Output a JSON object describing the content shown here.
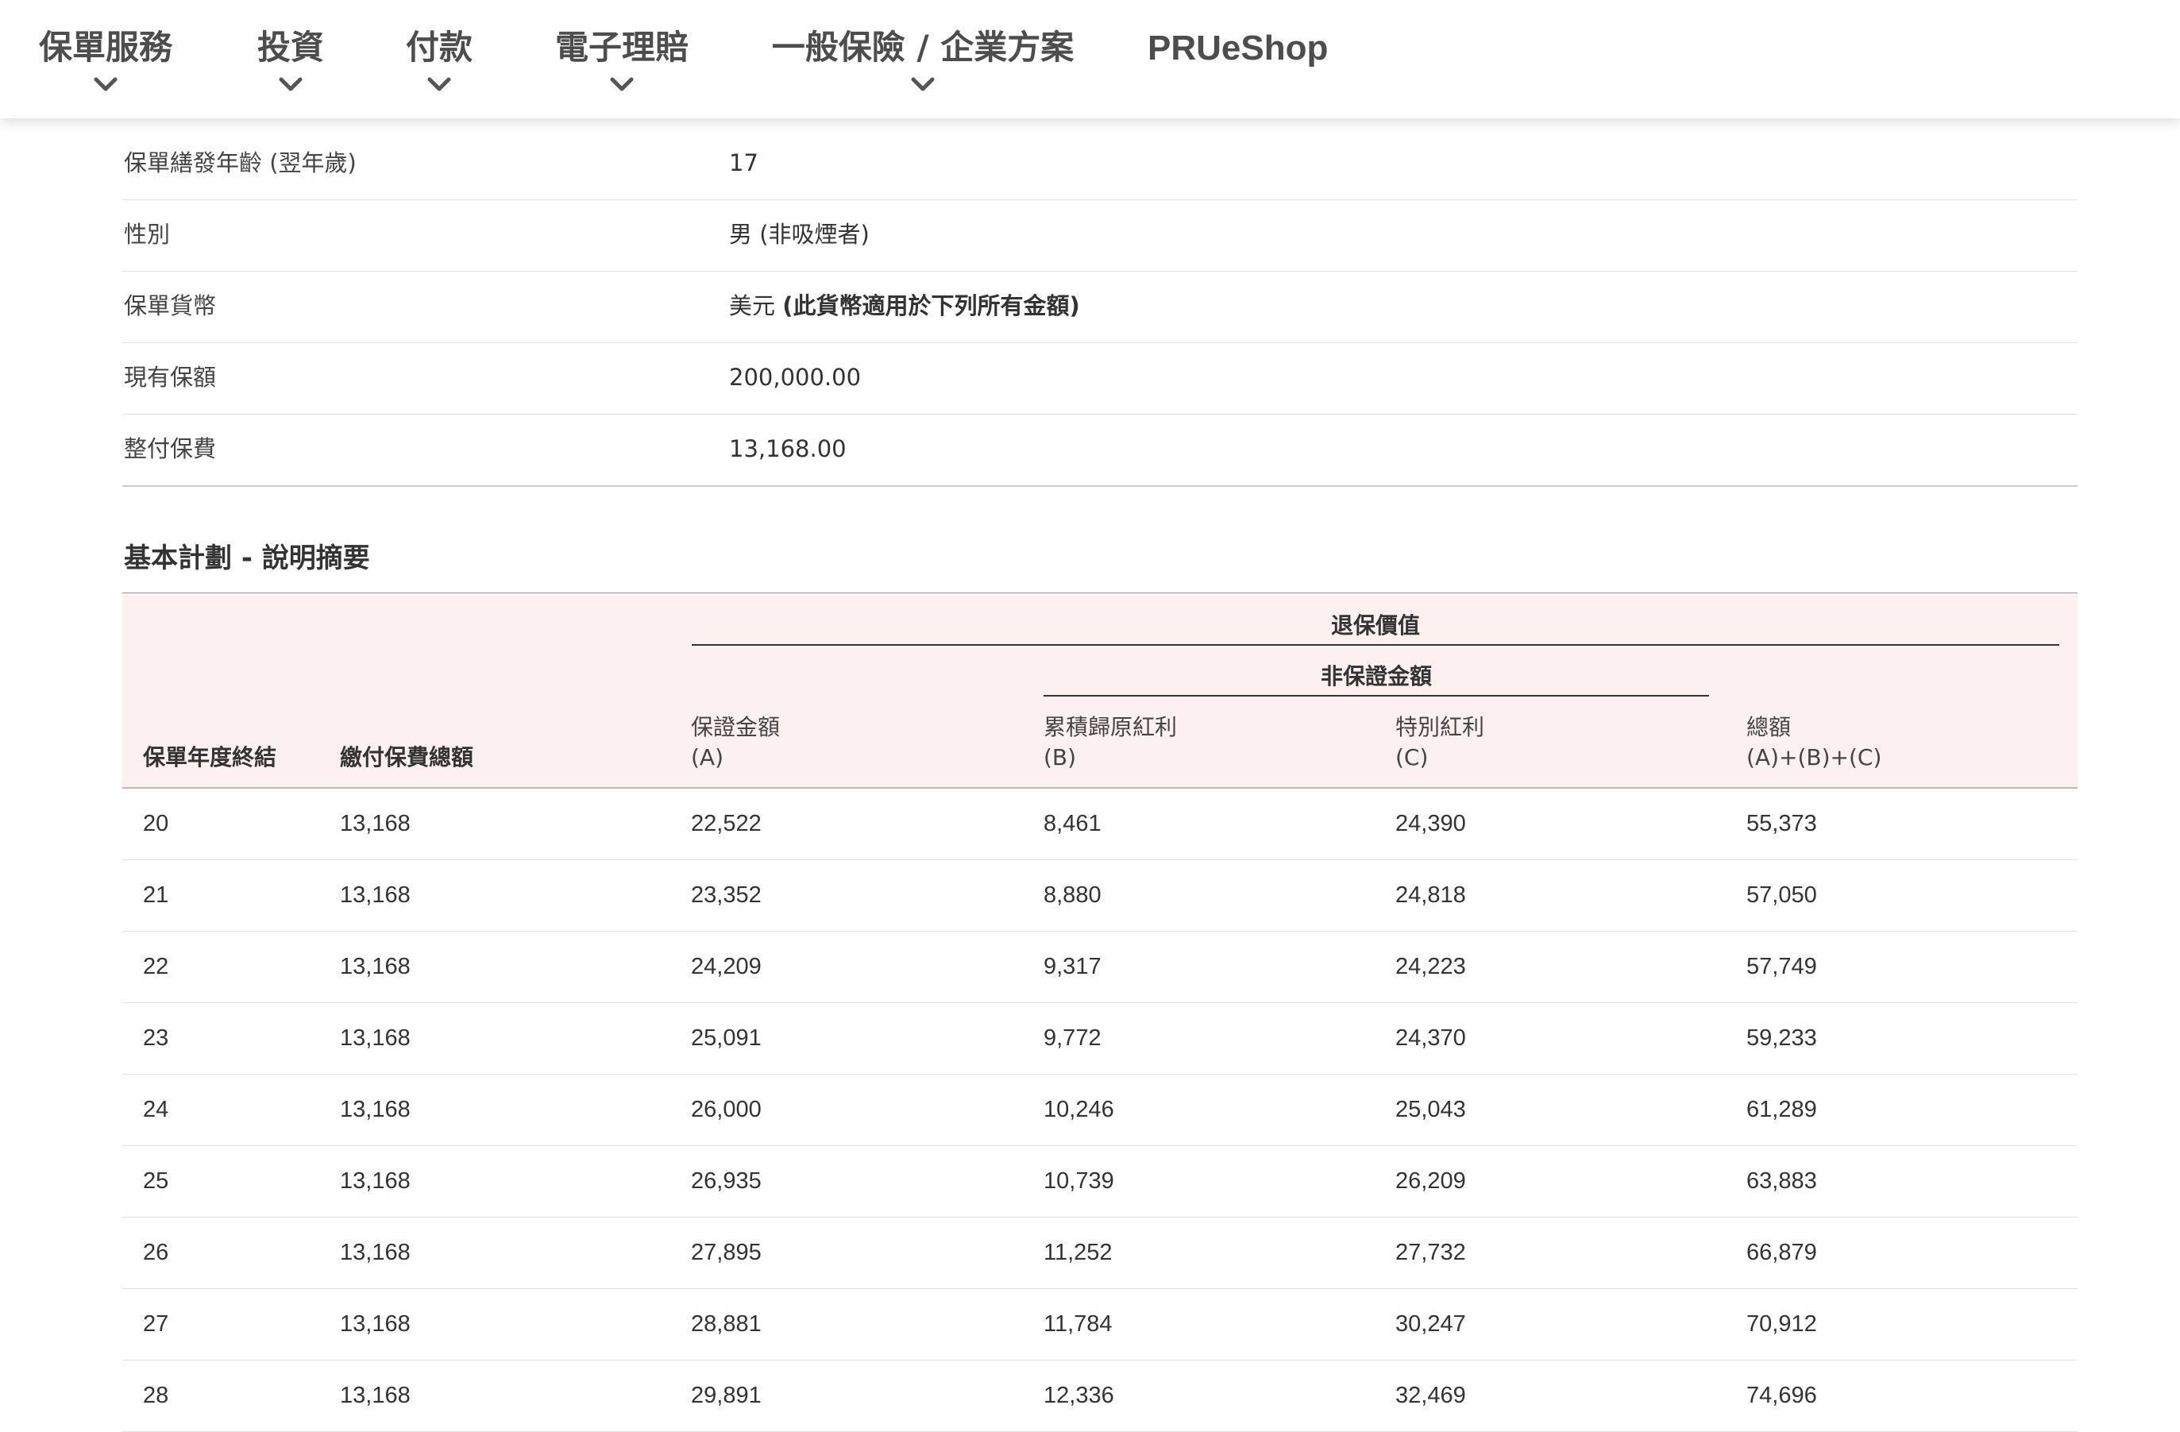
{
  "nav": {
    "items": [
      {
        "label": "保單服務",
        "has_dropdown": true
      },
      {
        "label": "投資",
        "has_dropdown": true
      },
      {
        "label": "付款",
        "has_dropdown": true
      },
      {
        "label": "電子理賠",
        "has_dropdown": true
      },
      {
        "label": "一般保險 / 企業方案",
        "has_dropdown": true
      },
      {
        "label": "PRUeShop",
        "has_dropdown": false
      }
    ]
  },
  "policy_info": [
    {
      "label": "保單繕發年齡 (翌年歲)",
      "value": "17",
      "value_note": ""
    },
    {
      "label": "性別",
      "value": "男 (非吸煙者)",
      "value_note": ""
    },
    {
      "label": "保單貨幣",
      "value": "美元",
      "value_note": "(此貨幣適用於下列所有金額)"
    },
    {
      "label": "現有保額",
      "value": "200,000.00",
      "value_note": ""
    },
    {
      "label": "整付保費",
      "value": "13,168.00",
      "value_note": ""
    }
  ],
  "section_title": "基本計劃 - 說明摘要",
  "table": {
    "group_header": "退保價值",
    "subgroup_header": "非保證金額",
    "columns": [
      {
        "line1": "保單年度終結",
        "line2": ""
      },
      {
        "line1": "繳付保費總額",
        "line2": ""
      },
      {
        "line1": "保證金額",
        "line2": "(A)"
      },
      {
        "line1": "累積歸原紅利",
        "line2": "(B)"
      },
      {
        "line1": "特別紅利",
        "line2": "(C)"
      },
      {
        "line1": "總額",
        "line2": "(A)+(B)+(C)"
      }
    ],
    "rows": [
      [
        "20",
        "13,168",
        "22,522",
        "8,461",
        "24,390",
        "55,373"
      ],
      [
        "21",
        "13,168",
        "23,352",
        "8,880",
        "24,818",
        "57,050"
      ],
      [
        "22",
        "13,168",
        "24,209",
        "9,317",
        "24,223",
        "57,749"
      ],
      [
        "23",
        "13,168",
        "25,091",
        "9,772",
        "24,370",
        "59,233"
      ],
      [
        "24",
        "13,168",
        "26,000",
        "10,246",
        "25,043",
        "61,289"
      ],
      [
        "25",
        "13,168",
        "26,935",
        "10,739",
        "26,209",
        "63,883"
      ],
      [
        "26",
        "13,168",
        "27,895",
        "11,252",
        "27,732",
        "66,879"
      ],
      [
        "27",
        "13,168",
        "28,881",
        "11,784",
        "30,247",
        "70,912"
      ],
      [
        "28",
        "13,168",
        "29,891",
        "12,336",
        "32,469",
        "74,696"
      ]
    ]
  },
  "colors": {
    "nav_text": "#4d4d4d",
    "header_bg": "#fdf0f0",
    "row_divider": "#e2e2e2"
  }
}
